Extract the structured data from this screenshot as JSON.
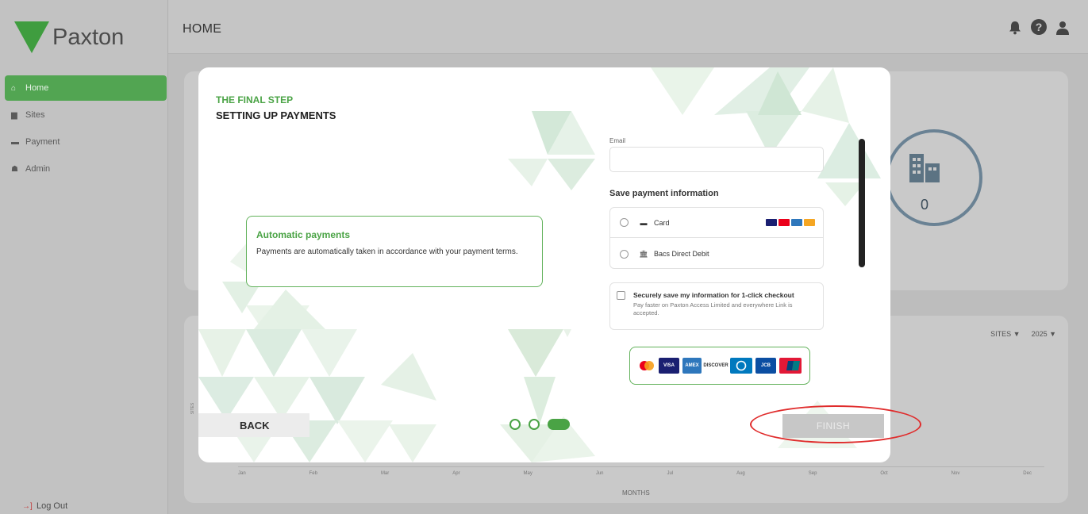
{
  "app": {
    "logo_text": "Paxton",
    "page_title": "HOME"
  },
  "sidebar": {
    "items": [
      {
        "label": "Home",
        "icon": "home-icon",
        "active": true
      },
      {
        "label": "Sites",
        "icon": "building-icon",
        "active": false
      },
      {
        "label": "Payment",
        "icon": "card-icon",
        "active": false
      },
      {
        "label": "Admin",
        "icon": "user-icon",
        "active": false
      }
    ],
    "logout_label": "Log Out"
  },
  "dashboard": {
    "sites_count": "0",
    "filters": {
      "sites_label": "SITES ▼",
      "year_label": "2025 ▼"
    },
    "months": [
      "Jan",
      "Feb",
      "Mar",
      "Apr",
      "May",
      "Jun",
      "Jul",
      "Aug",
      "Sep",
      "Oct",
      "Nov",
      "Dec"
    ],
    "x_axis_label": "MONTHS",
    "y_axis_label": "SITES"
  },
  "modal": {
    "step_title": "THE FINAL STEP",
    "heading": "SETTING UP PAYMENTS",
    "info_box": {
      "title": "Automatic payments",
      "text": "Payments are automatically taken in accordance with your payment terms."
    },
    "form": {
      "email_label": "Email",
      "email_value": "",
      "save_payment_title": "Save payment information",
      "payment_methods": [
        {
          "label": "Card",
          "icon": "card-icon"
        },
        {
          "label": "Bacs Direct Debit",
          "icon": "bank-icon"
        }
      ],
      "save_checkbox_title": "Securely save my information for 1-click checkout",
      "save_checkbox_sub": "Pay faster on Paxton Access Limited and everywhere Link is accepted."
    },
    "card_brands": [
      "Mastercard",
      "VISA",
      "AMEX",
      "DISCOVER",
      "Diners",
      "JCB",
      "UnionPay"
    ],
    "back_label": "BACK",
    "finish_label": "FINISH",
    "step_count": 3,
    "current_step": 3
  },
  "colors": {
    "brand_green": "#4aa345",
    "highlight_red": "#e02c2c",
    "overlay_gray": "#bdbdbd"
  }
}
